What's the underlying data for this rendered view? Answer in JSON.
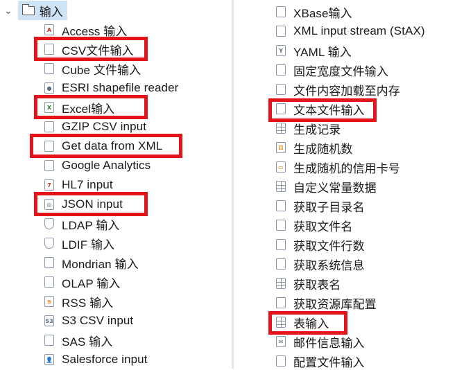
{
  "tree": {
    "root": {
      "label": "输入",
      "icon": "folder-icon",
      "expanded": true
    },
    "left_items": [
      {
        "label": "Access 输入",
        "icon": "access-file-icon",
        "highlighted": false
      },
      {
        "label": "CSV文件输入",
        "icon": "csv-file-icon",
        "highlighted": true
      },
      {
        "label": "Cube 文件输入",
        "icon": "cube-file-icon",
        "highlighted": false
      },
      {
        "label": "ESRI shapefile reader",
        "icon": "map-pin-icon",
        "highlighted": false
      },
      {
        "label": "Excel输入",
        "icon": "excel-file-icon",
        "highlighted": true
      },
      {
        "label": "GZIP CSV input",
        "icon": "gzip-file-icon",
        "highlighted": false
      },
      {
        "label": "Get data from XML",
        "icon": "xml-file-icon",
        "highlighted": true
      },
      {
        "label": "Google Analytics",
        "icon": "analytics-icon",
        "highlighted": false
      },
      {
        "label": "HL7 input",
        "icon": "hl7-icon",
        "highlighted": false
      },
      {
        "label": "JSON input",
        "icon": "json-icon",
        "highlighted": true
      },
      {
        "label": "LDAP 输入",
        "icon": "ldap-shield-icon",
        "highlighted": false
      },
      {
        "label": "LDIF 输入",
        "icon": "ldif-shield-icon",
        "highlighted": false
      },
      {
        "label": "Mondrian 输入",
        "icon": "mondrian-icon",
        "highlighted": false
      },
      {
        "label": "OLAP 输入",
        "icon": "olap-icon",
        "highlighted": false
      },
      {
        "label": "RSS 输入",
        "icon": "rss-icon",
        "highlighted": false
      },
      {
        "label": "S3 CSV input",
        "icon": "s3-icon",
        "highlighted": false
      },
      {
        "label": "SAS 输入",
        "icon": "sas-icon",
        "highlighted": false
      },
      {
        "label": "Salesforce input",
        "icon": "salesforce-icon",
        "highlighted": false
      }
    ],
    "right_items": [
      {
        "label": "XBase输入",
        "icon": "xbase-file-icon",
        "highlighted": false
      },
      {
        "label": "XML input stream (StAX)",
        "icon": "xml-stream-icon",
        "highlighted": false
      },
      {
        "label": "YAML 输入",
        "icon": "yaml-icon",
        "highlighted": false
      },
      {
        "label": "固定宽度文件输入",
        "icon": "fixed-width-file-icon",
        "highlighted": false
      },
      {
        "label": "文件内容加载至内存",
        "icon": "load-file-icon",
        "highlighted": false
      },
      {
        "label": "文本文件输入",
        "icon": "text-file-icon",
        "highlighted": true
      },
      {
        "label": "生成记录",
        "icon": "generate-rows-icon",
        "highlighted": false
      },
      {
        "label": "生成随机数",
        "icon": "random-dice-icon",
        "highlighted": false
      },
      {
        "label": "生成随机的信用卡号",
        "icon": "credit-card-icon",
        "highlighted": false
      },
      {
        "label": "自定义常量数据",
        "icon": "constant-grid-icon",
        "highlighted": false
      },
      {
        "label": "获取子目录名",
        "icon": "subfolder-icon",
        "highlighted": false
      },
      {
        "label": "获取文件名",
        "icon": "get-filename-icon",
        "highlighted": false
      },
      {
        "label": "获取文件行数",
        "icon": "file-rows-icon",
        "highlighted": false
      },
      {
        "label": "获取系统信息",
        "icon": "system-info-icon",
        "highlighted": false
      },
      {
        "label": "获取表名",
        "icon": "table-name-icon",
        "highlighted": false
      },
      {
        "label": "获取资源库配置",
        "icon": "repository-config-icon",
        "highlighted": false
      },
      {
        "label": "表输入",
        "icon": "table-input-icon",
        "highlighted": true
      },
      {
        "label": "邮件信息输入",
        "icon": "mail-icon",
        "highlighted": false
      },
      {
        "label": "配置文件输入",
        "icon": "config-file-icon",
        "highlighted": false
      }
    ]
  },
  "colors": {
    "highlight_box": "#e5141b",
    "selection_bg": "#cfe3f7"
  }
}
